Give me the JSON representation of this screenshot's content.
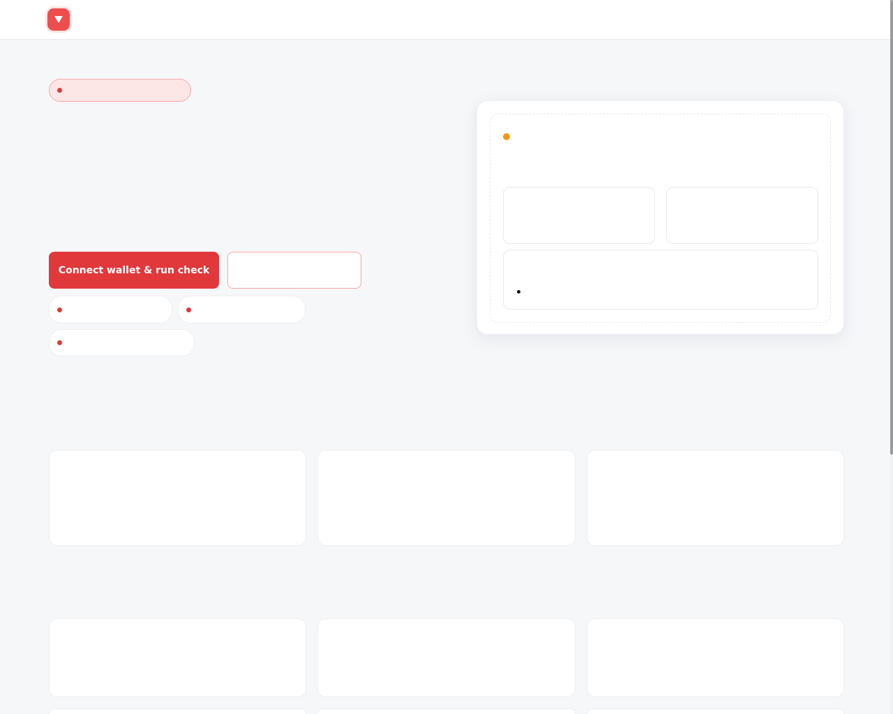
{
  "header": {
    "logo_icon": "down-triangle-icon",
    "brand_color": "#ef4d4d"
  },
  "hero": {
    "badge_text": "",
    "primary_button_label": "Connect wallet & run check",
    "secondary_button_label": "",
    "feature_pills": [
      "",
      "",
      ""
    ]
  },
  "result_panel": {
    "status_color": "#f29a12",
    "status_text": "",
    "stats": [
      {
        "label": "",
        "value": ""
      },
      {
        "label": "",
        "value": ""
      }
    ],
    "notes": [
      ""
    ]
  },
  "feature_cards": [
    {
      "title": "",
      "body": ""
    },
    {
      "title": "",
      "body": ""
    },
    {
      "title": "",
      "body": ""
    }
  ],
  "info_cards": [
    {
      "title": "",
      "body": ""
    },
    {
      "title": "",
      "body": ""
    },
    {
      "title": "",
      "body": ""
    }
  ],
  "colors": {
    "accent": "#e0383b",
    "warning": "#f29a12",
    "background": "#f6f7f9"
  }
}
